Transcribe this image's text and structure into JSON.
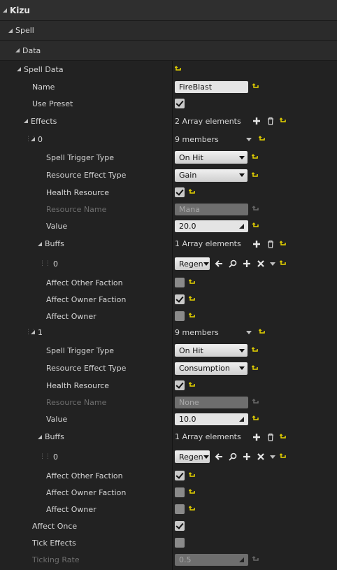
{
  "categories": {
    "kizu": "Kizu",
    "spell": "Spell",
    "data": "Data"
  },
  "spell_data": {
    "label": "Spell Data",
    "name_label": "Name",
    "name_value": "FireBlast",
    "use_preset_label": "Use Preset",
    "effects_label": "Effects",
    "effects_count": "2 Array elements",
    "effects": [
      {
        "index": "0",
        "members": "9 members",
        "trigger_label": "Spell Trigger Type",
        "trigger_value": "On Hit",
        "resource_effect_label": "Resource Effect Type",
        "resource_effect_value": "Gain",
        "health_label": "Health Resource",
        "resource_name_label": "Resource Name",
        "resource_name_value": "Mana",
        "value_label": "Value",
        "value_value": "20.0",
        "buffs_label": "Buffs",
        "buffs_count": "1 Array elements",
        "buff_index": "0",
        "buff_value": "Regen",
        "other_faction_label": "Affect Other Faction",
        "owner_faction_label": "Affect Owner Faction",
        "owner_label": "Affect Owner"
      },
      {
        "index": "1",
        "members": "9 members",
        "trigger_label": "Spell Trigger Type",
        "trigger_value": "On Hit",
        "resource_effect_label": "Resource Effect Type",
        "resource_effect_value": "Consumption",
        "health_label": "Health Resource",
        "resource_name_label": "Resource Name",
        "resource_name_value": "None",
        "value_label": "Value",
        "value_value": "10.0",
        "buffs_label": "Buffs",
        "buffs_count": "1 Array elements",
        "buff_index": "0",
        "buff_value": "Regen",
        "other_faction_label": "Affect Other Faction",
        "owner_faction_label": "Affect Owner Faction",
        "owner_label": "Affect Owner"
      }
    ],
    "affect_once_label": "Affect Once",
    "tick_effects_label": "Tick Effects",
    "ticking_rate_label": "Ticking Rate",
    "ticking_rate_value": "0.5"
  },
  "icons": {
    "reset": "reset-arrow-icon",
    "add": "plus-icon",
    "delete": "trash-icon",
    "use_selected": "arrow-left-icon",
    "browse": "search-icon",
    "clear": "x-icon"
  },
  "colors": {
    "reset_arrow": "#e8d400",
    "panel_bg": "#222222",
    "category_bg": "#2f2f2f"
  }
}
